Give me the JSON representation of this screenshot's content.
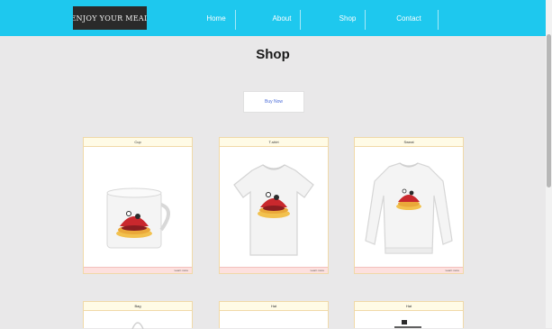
{
  "header": {
    "logo_text": "ENJOY YOUR MEAL",
    "nav": [
      {
        "label": "Home"
      },
      {
        "label": "About"
      },
      {
        "label": "Shop"
      },
      {
        "label": "Contact"
      }
    ]
  },
  "main": {
    "title": "Shop",
    "buy_button": "Buy Now"
  },
  "products_row1": [
    {
      "name": "Cup",
      "footer": "Learn more",
      "icon": "mug-icon"
    },
    {
      "name": "T-shirt",
      "footer": "Learn more",
      "icon": "tshirt-icon"
    },
    {
      "name": "Sweat",
      "footer": "Learn more",
      "icon": "sweatshirt-icon"
    }
  ],
  "products_row2": [
    {
      "name": "Bag"
    },
    {
      "name": "Hat"
    },
    {
      "name": "Hat"
    }
  ],
  "colors": {
    "header_bg": "#1ec8ee",
    "page_bg": "#e9e8e9",
    "card_head_bg": "#fffbe6",
    "card_foot_bg": "#fde0de",
    "button_text": "#4a6bd8"
  }
}
